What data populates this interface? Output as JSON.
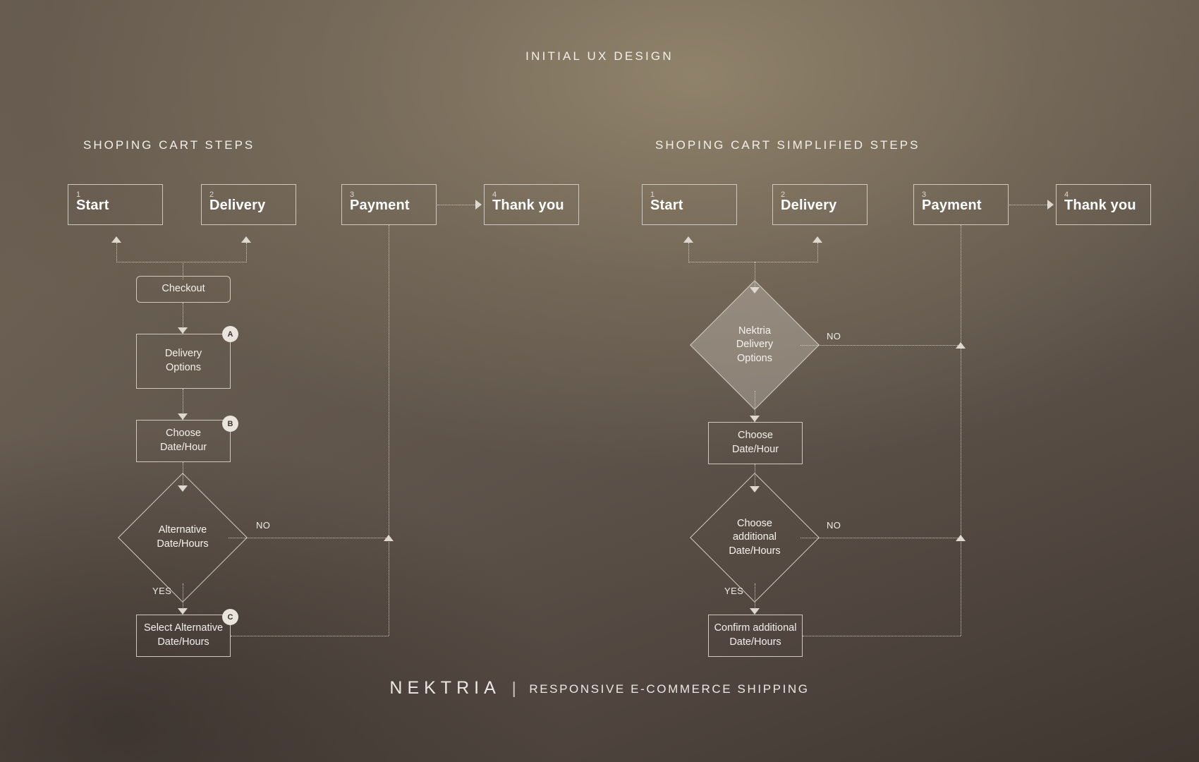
{
  "page": {
    "title": "INITIAL UX DESIGN",
    "footer_brand": "NEKTRIA",
    "footer_separator": "|",
    "footer_tagline": "RESPONSIVE E-COMMERCE SHIPPING",
    "background_color": "#5e5349",
    "line_color": "#cfc8bd",
    "text_color": "#f3f0ea",
    "badge_fill": "#e9e5dd"
  },
  "sections": [
    {
      "id": "left",
      "title": "SHOPING CART STEPS"
    },
    {
      "id": "right",
      "title": "SHOPING CART SIMPLIFIED STEPS"
    }
  ],
  "left_flow": {
    "steps": [
      {
        "num": "1",
        "label": "Start"
      },
      {
        "num": "2",
        "label": "Delivery"
      },
      {
        "num": "3",
        "label": "Payment"
      },
      {
        "num": "4",
        "label": "Thank you"
      }
    ],
    "nodes": [
      {
        "id": "checkout",
        "label": "Checkout",
        "shape": "rounded-rect",
        "badge": ""
      },
      {
        "id": "delivery-options",
        "label": "Delivery\nOptions",
        "shape": "rect",
        "badge": "A"
      },
      {
        "id": "choose-date-hour",
        "label": "Choose\nDate/Hour",
        "shape": "rect",
        "badge": "B"
      },
      {
        "id": "alternative-date-hours",
        "label": "Alternative\nDate/Hours",
        "shape": "diamond",
        "badge": ""
      },
      {
        "id": "select-alternative",
        "label": "Select Alternative\nDate/Hours",
        "shape": "rect",
        "badge": "C"
      }
    ],
    "labels": {
      "checkout": "Checkout",
      "delivery_options_l1": "Delivery",
      "delivery_options_l2": "Options",
      "choose_l1": "Choose",
      "choose_l2": "Date/Hour",
      "alternative_l1": "Alternative",
      "alternative_l2": "Date/Hours",
      "select_l1": "Select Alternative",
      "select_l2": "Date/Hours",
      "badge_a": "A",
      "badge_b": "B",
      "badge_c": "C",
      "branch_no": "NO",
      "branch_yes": "YES"
    }
  },
  "right_flow": {
    "steps": [
      {
        "num": "1",
        "label": "Start"
      },
      {
        "num": "2",
        "label": "Delivery"
      },
      {
        "num": "3",
        "label": "Payment"
      },
      {
        "num": "4",
        "label": "Thank you"
      }
    ],
    "labels": {
      "nektria_l1": "Nektria",
      "nektria_l2": "Delivery",
      "nektria_l3": "Options",
      "choose_l1": "Choose",
      "choose_l2": "Date/Hour",
      "choose_add_l1": "Choose",
      "choose_add_l2": "additional",
      "choose_add_l3": "Date/Hours",
      "confirm_l1": "Confirm additional",
      "confirm_l2": "Date/Hours",
      "branch_no": "NO",
      "branch_yes": "YES"
    }
  }
}
